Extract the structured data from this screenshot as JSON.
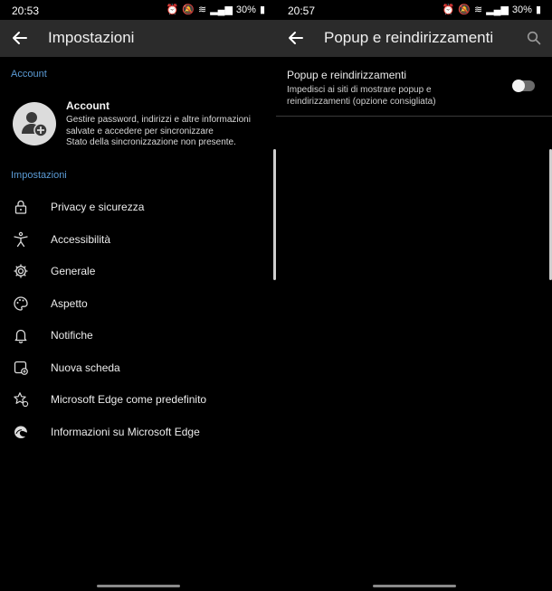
{
  "left": {
    "status": {
      "time": "20:53",
      "battery": "30%"
    },
    "appbar": {
      "title": "Impostazioni"
    },
    "account_section": "Account",
    "account": {
      "title": "Account",
      "description": "Gestire password, indirizzi e altre informazioni salvate e accedere per sincronizzare",
      "sync_status": "Stato della sincronizzazione non presente."
    },
    "settings_section": "Impostazioni",
    "items": [
      {
        "label": "Privacy e sicurezza",
        "icon": "lock-icon"
      },
      {
        "label": "Accessibilità",
        "icon": "accessibility-icon"
      },
      {
        "label": "Generale",
        "icon": "gear-icon"
      },
      {
        "label": "Aspetto",
        "icon": "palette-icon"
      },
      {
        "label": "Notifiche",
        "icon": "bell-icon"
      },
      {
        "label": "Nuova scheda",
        "icon": "new-tab-icon"
      },
      {
        "label": "Microsoft Edge come predefinito",
        "icon": "star-settings-icon"
      },
      {
        "label": "Informazioni su Microsoft Edge",
        "icon": "edge-logo-icon"
      }
    ]
  },
  "right": {
    "status": {
      "time": "20:57",
      "battery": "30%"
    },
    "appbar": {
      "title": "Popup e reindirizzamenti"
    },
    "preference": {
      "title": "Popup e reindirizzamenti",
      "description": "Impedisci ai siti di mostrare popup e reindirizzamenti (opzione consigliata)",
      "enabled": false
    }
  },
  "colors": {
    "background": "#000000",
    "appbar": "#2b2b2b",
    "accent": "#5b9bd5"
  }
}
